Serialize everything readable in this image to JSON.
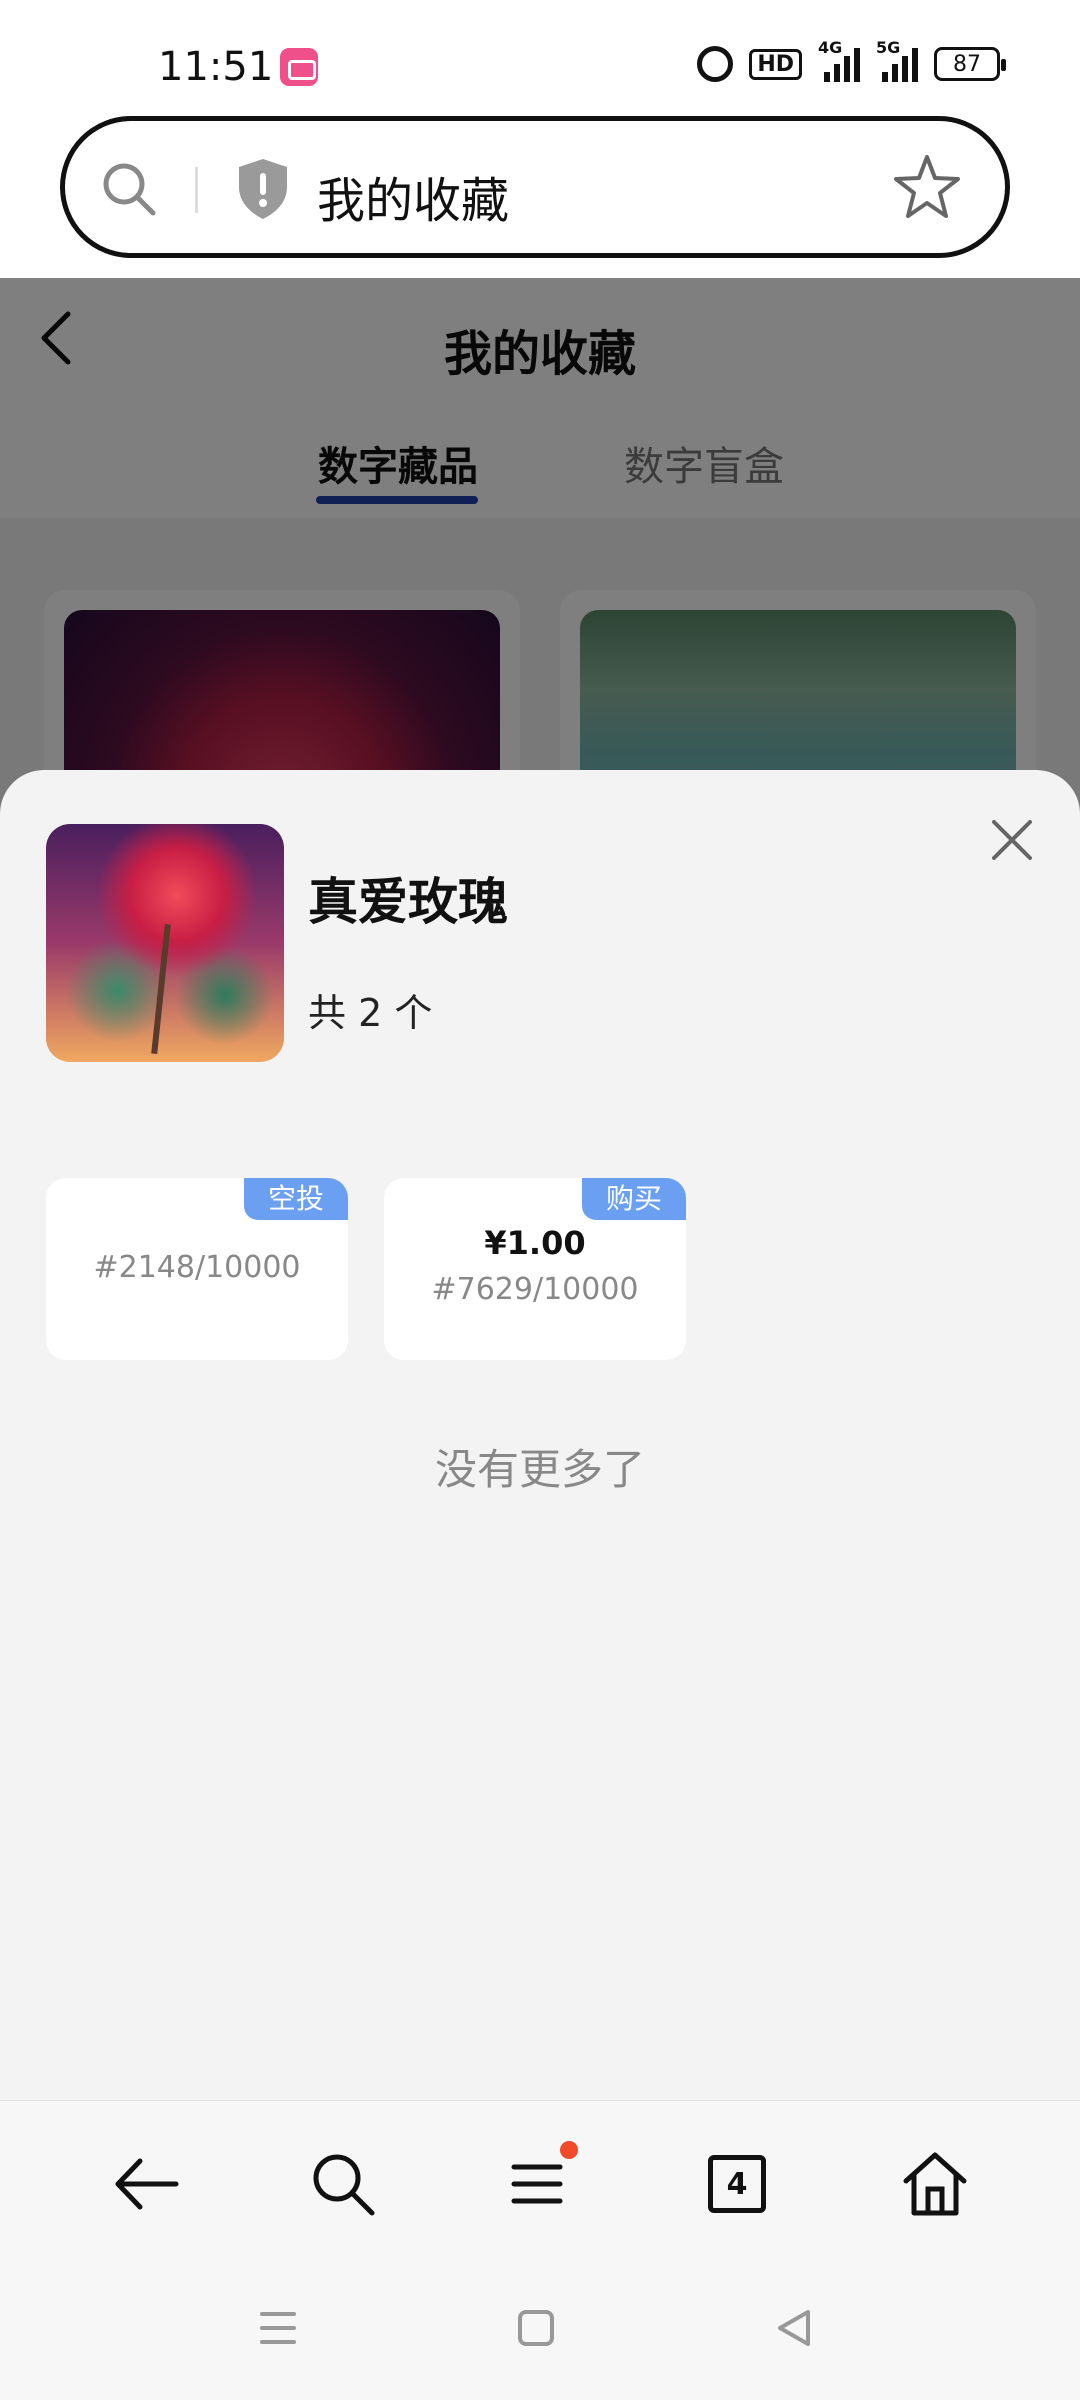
{
  "status_bar": {
    "time": "11:51",
    "hd_label": "HD",
    "network_4g": "4G",
    "network_5g": "5G",
    "battery": "87"
  },
  "url_bar": {
    "text": "我的收藏"
  },
  "page": {
    "title": "我的收藏",
    "tabs": [
      {
        "label": "数字藏品",
        "active": true
      },
      {
        "label": "数字盲盒",
        "active": false
      }
    ]
  },
  "sheet": {
    "item_name": "真爱玫瑰",
    "count_text": "共 2 个",
    "tokens": [
      {
        "tag": "空投",
        "price": "",
        "serial": "#2148/10000"
      },
      {
        "tag": "购买",
        "price": "¥1.00",
        "serial": "#7629/10000"
      }
    ],
    "end_text": "没有更多了"
  },
  "toolbar": {
    "tab_count": "4"
  },
  "colors": {
    "accent_underline": "#2140a8",
    "tag_blue": "#6a9ff2",
    "notification_dot": "#f04a2a",
    "app_badge": "#f0508a"
  }
}
